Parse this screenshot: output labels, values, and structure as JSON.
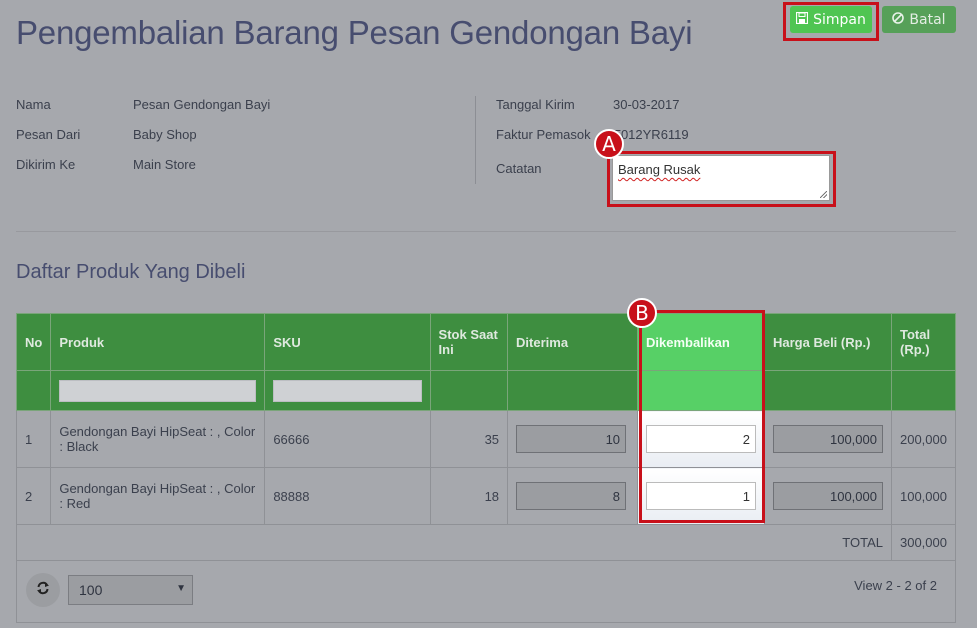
{
  "header": {
    "title": "Pengembalian Barang Pesan Gendongan Bayi",
    "save_label": "Simpan",
    "cancel_label": "Batal"
  },
  "info_left": [
    {
      "label": "Nama",
      "value": "Pesan Gendongan Bayi"
    },
    {
      "label": "Pesan Dari",
      "value": "Baby Shop"
    },
    {
      "label": "Dikirim Ke",
      "value": "Main Store"
    }
  ],
  "info_right": [
    {
      "label": "Tanggal Kirim",
      "value": "30-03-2017"
    },
    {
      "label": "Faktur Pemasok",
      "value": "F012YR6119"
    },
    {
      "label": "Catatan",
      "value": "Barang Rusak"
    }
  ],
  "badges": {
    "a": "A",
    "b": "B"
  },
  "section_title": "Daftar Produk Yang Dibeli",
  "table": {
    "headers": [
      "No",
      "Produk",
      "SKU",
      "Stok Saat Ini",
      "Diterima",
      "Dikembalikan",
      "Harga Beli (Rp.)",
      "Total (Rp.)"
    ],
    "rows": [
      {
        "no": "1",
        "product": "Gendongan Bayi HipSeat : , Color : Black",
        "sku": "66666",
        "stock": "35",
        "received": "10",
        "returned": "2",
        "price": "100,000",
        "total": "200,000"
      },
      {
        "no": "2",
        "product": "Gendongan Bayi HipSeat : , Color : Red",
        "sku": "88888",
        "stock": "18",
        "received": "8",
        "returned": "1",
        "price": "100,000",
        "total": "100,000"
      }
    ],
    "total_label": "TOTAL",
    "total_value": "300,000"
  },
  "pagination": {
    "page_size": "100",
    "view_info": "View 2 - 2 of 2"
  },
  "colors": {
    "header_green": "#3e8e40",
    "highlight_green": "#57d066",
    "annotation_red": "#c8101a",
    "save_green": "#4fc552"
  },
  "icons": {
    "save": "floppy-disk-icon",
    "cancel": "ban-icon",
    "refresh": "refresh-icon",
    "dropdown": "chevron-down-icon"
  }
}
